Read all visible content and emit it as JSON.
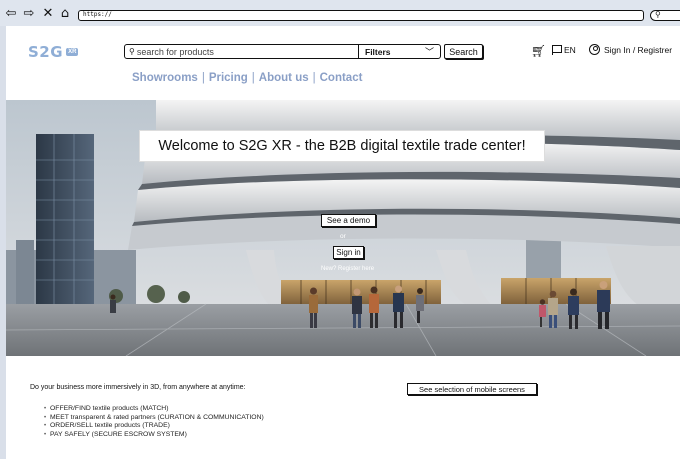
{
  "browser": {
    "url": "https://",
    "back_icon": "arrow-left",
    "forward_icon": "arrow-right",
    "stop_icon": "x",
    "home_icon": "house"
  },
  "header": {
    "logo_text": "S2G",
    "logo_badge": "XR",
    "search_placeholder": "search for products",
    "filters_label": "Filters",
    "search_button": "Search",
    "language": "EN",
    "signin_label": "Sign In / Registrer"
  },
  "nav": {
    "items": [
      "Showrooms",
      "Pricing",
      "About us",
      "Contact"
    ]
  },
  "hero": {
    "title": "Welcome to S2G XR - the B2B digital textile trade center!",
    "demo_button": "See a demo",
    "or_text": "or",
    "signin_button": "Sign in",
    "register_link": "New? Register here"
  },
  "content": {
    "tagline": "Do your business more immersively in 3D, from anywhere at anytime:",
    "mobile_button": "See selection of mobile screens",
    "features": [
      "OFFER/FIND textile products (MATCH)",
      "MEET transparent & rated partners (CURATION & COMMUNICATION)",
      "ORDER/SELL textile products (TRADE)",
      "PAY SAFELY (SECURE ESCROW SYSTEM)"
    ]
  },
  "colors": {
    "accent": "#8faed6",
    "nav_text": "#8a9fc6",
    "chrome_bg": "#dfe5ee"
  }
}
